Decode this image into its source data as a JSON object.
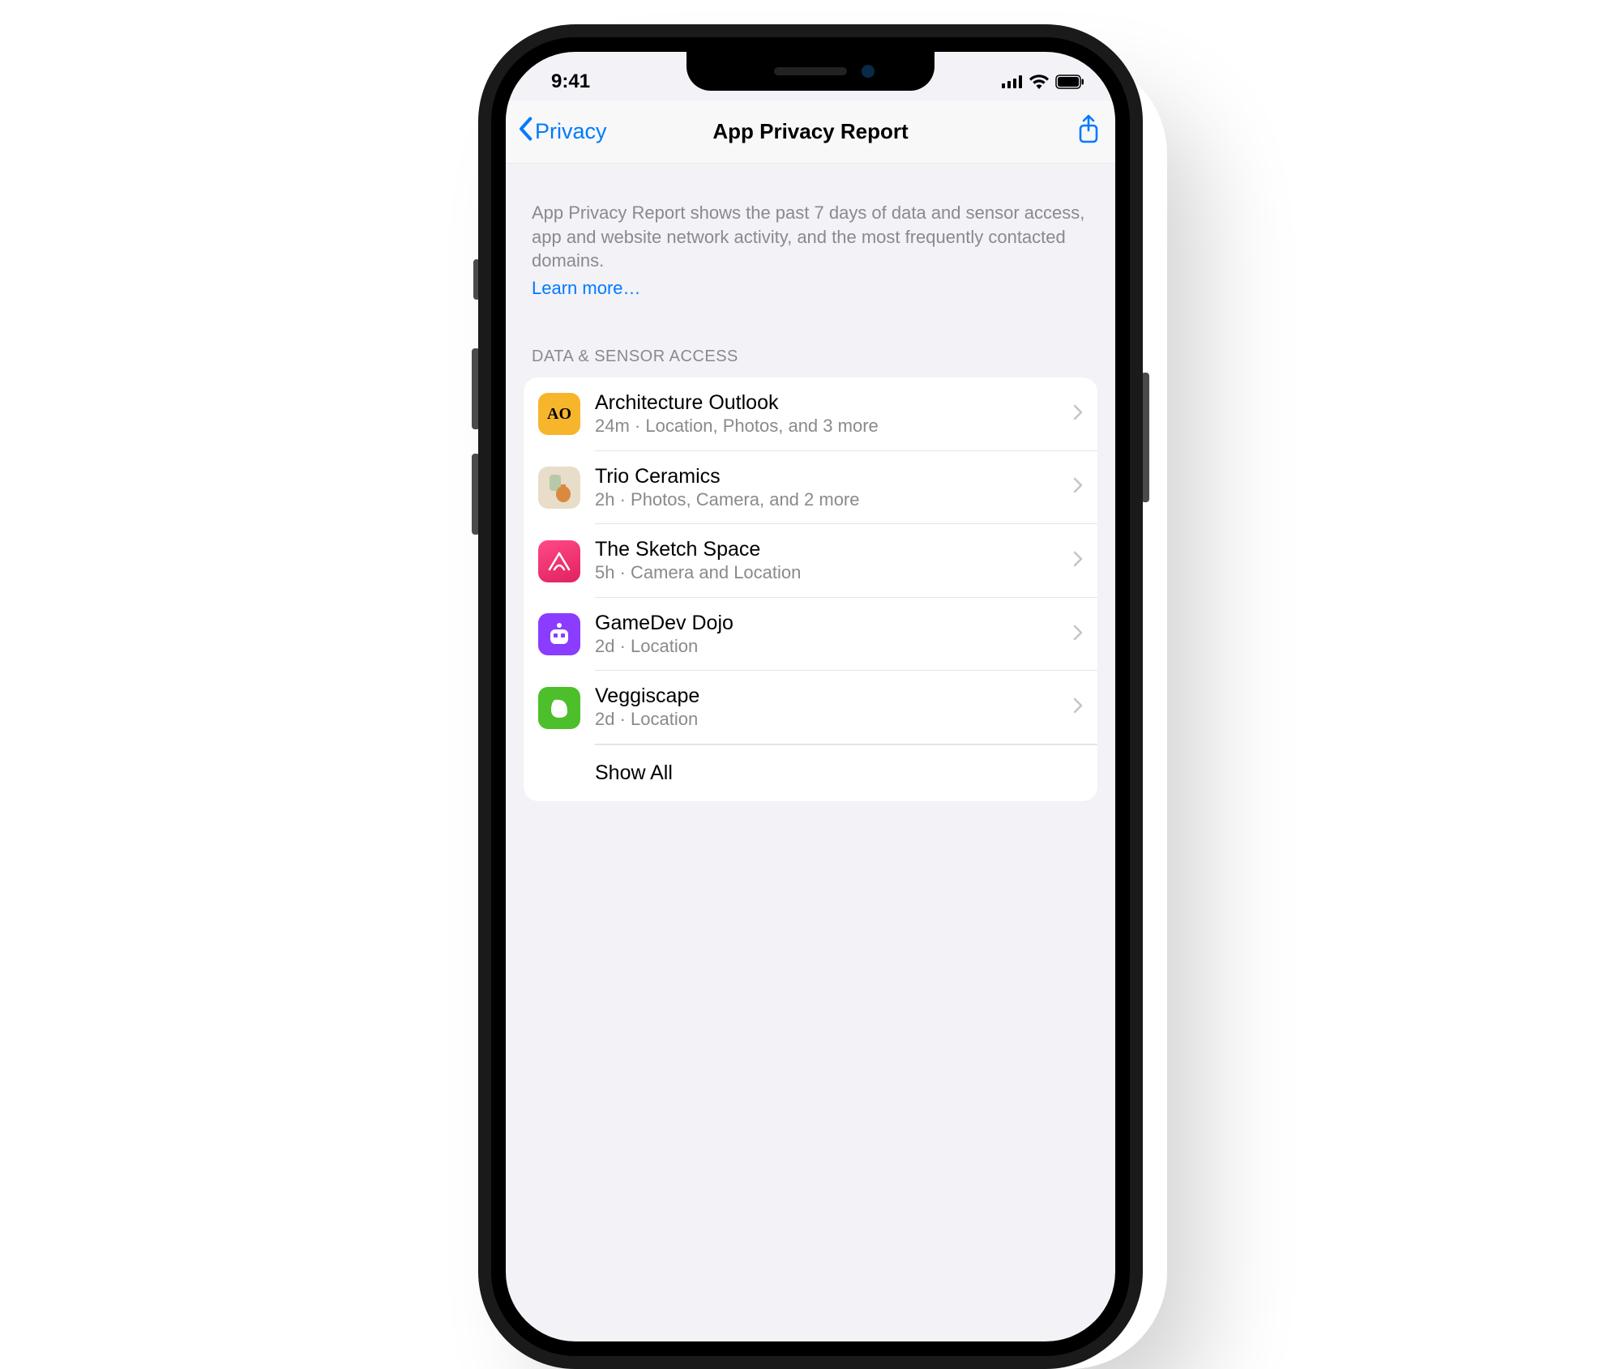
{
  "statusbar": {
    "time": "9:41"
  },
  "nav": {
    "back_label": "Privacy",
    "title": "App Privacy Report"
  },
  "intro": {
    "text": "App Privacy Report shows the past 7 days of data and sensor access, app and website network activity, and the most frequently contacted domains.",
    "link": "Learn more…"
  },
  "section_header": "DATA & SENSOR ACCESS",
  "rows": [
    {
      "name": "Architecture Outlook",
      "sub": "24m · Location, Photos, and 3 more",
      "icon": "ao"
    },
    {
      "name": "Trio Ceramics",
      "sub": "2h · Photos, Camera, and 2 more",
      "icon": "trio"
    },
    {
      "name": "The Sketch Space",
      "sub": "5h · Camera and Location",
      "icon": "sketch"
    },
    {
      "name": "GameDev Dojo",
      "sub": "2d · Location",
      "icon": "dojo"
    },
    {
      "name": "Veggiscape",
      "sub": "2d · Location",
      "icon": "veg"
    }
  ],
  "show_all": "Show All",
  "colors": {
    "ios_blue": "#007aff",
    "grouped_bg": "#f2f2f7",
    "secondary_text": "#8a8a8e"
  }
}
